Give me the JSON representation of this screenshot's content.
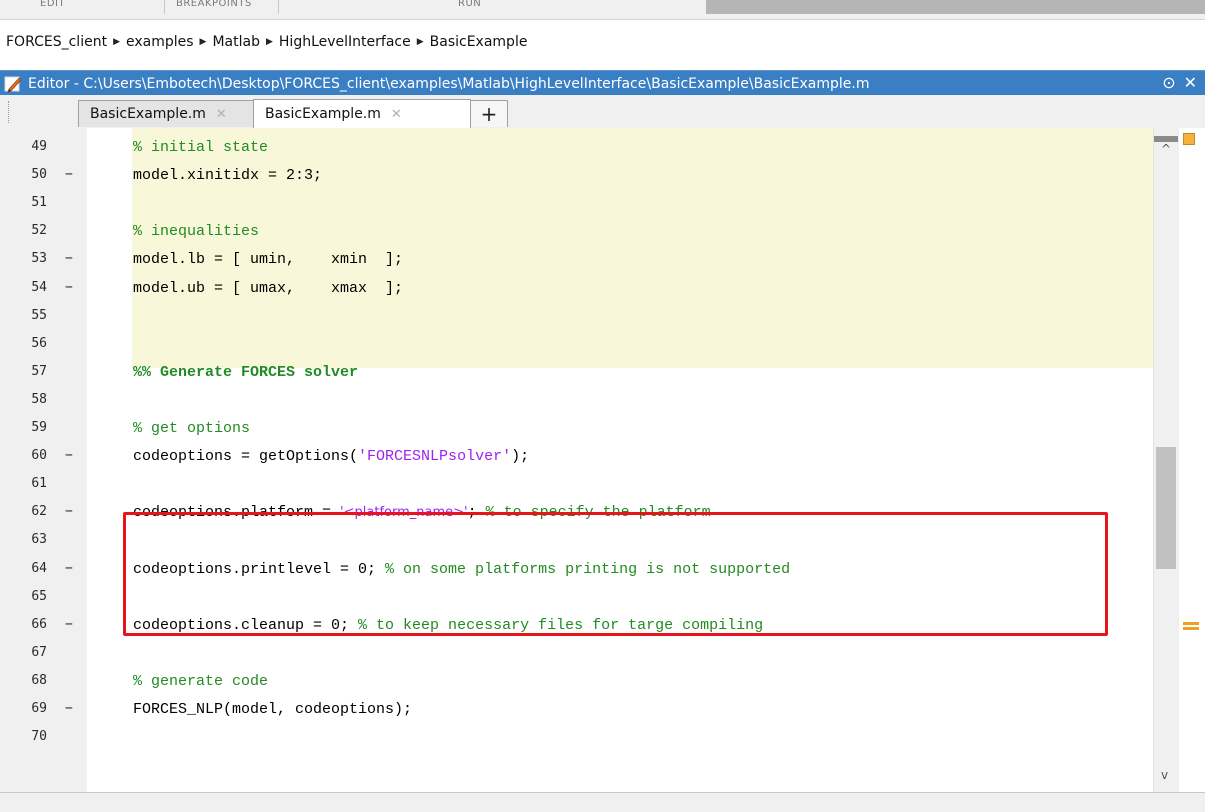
{
  "ribbon": {
    "sections": [
      "EDIT",
      "BREAKPOINTS",
      "RUN"
    ]
  },
  "breadcrumb": {
    "items": [
      "FORCES_client",
      "examples",
      "Matlab",
      "HighLevelInterface",
      "BasicExample"
    ],
    "separator": "▶"
  },
  "editor": {
    "title": "Editor - C:\\Users\\Embotech\\Desktop\\FORCES_client\\examples\\Matlab\\HighLevelInterface\\BasicExample\\BasicExample.m",
    "window_buttons": {
      "menu": "⊙",
      "close": "✕"
    },
    "tabs": [
      {
        "label": "BasicExample.m",
        "active": false
      },
      {
        "label": "BasicExample.m",
        "active": true
      }
    ],
    "tab_close_glyph": "✕",
    "new_tab_glyph": "+"
  },
  "code": {
    "lines": [
      {
        "n": "49",
        "exec": false
      },
      {
        "n": "50",
        "exec": true
      },
      {
        "n": "51",
        "exec": false
      },
      {
        "n": "52",
        "exec": false
      },
      {
        "n": "53",
        "exec": true
      },
      {
        "n": "54",
        "exec": true
      },
      {
        "n": "55",
        "exec": false
      },
      {
        "n": "56",
        "exec": false
      },
      {
        "n": "57",
        "exec": false
      },
      {
        "n": "58",
        "exec": false
      },
      {
        "n": "59",
        "exec": false
      },
      {
        "n": "60",
        "exec": true
      },
      {
        "n": "61",
        "exec": false
      },
      {
        "n": "62",
        "exec": true
      },
      {
        "n": "63",
        "exec": false
      },
      {
        "n": "64",
        "exec": true
      },
      {
        "n": "65",
        "exec": false
      },
      {
        "n": "66",
        "exec": true
      },
      {
        "n": "67",
        "exec": false
      },
      {
        "n": "68",
        "exec": false
      },
      {
        "n": "69",
        "exec": true
      },
      {
        "n": "70",
        "exec": false
      }
    ],
    "exec_marker": "−",
    "text": {
      "l49_comment": "% initial state",
      "l50": "model.xinitidx = 2:3;",
      "l52_comment": "% inequalities",
      "l53": "model.lb = [ umin,    xmin  ];",
      "l54": "model.ub = [ umax,    xmax  ];",
      "l57_cellhead": "%% Generate FORCES solver",
      "l59_comment": "% get options",
      "l60_a": "codeoptions = getOptions(",
      "l60_string": "'FORCESNLPsolver'",
      "l60_b": ");",
      "l62_a": "codeoptions.platform = ",
      "l62_string": "'<platform_name>'",
      "l62_b": "; ",
      "l62_comment": "% to specify the platform",
      "l64_a": "codeoptions.printlevel = 0; ",
      "l64_comment": "% on some platforms printing is not supported",
      "l66_a": "codeoptions.cleanup = 0; ",
      "l66_comment": "% to keep necessary files for targe compiling",
      "l68_comment": "% generate code",
      "l69": "FORCES_NLP(model, codeoptions);"
    }
  },
  "colors": {
    "title_bar": "#3a7fc4",
    "cell_highlight": "#f8f7d9",
    "comment": "#228b22",
    "string": "#a020f0",
    "callout_box": "#e8141b",
    "analyzer_status": "#f5b23b"
  },
  "icons": [
    "editor-pencil-icon",
    "window-menu-icon",
    "close-icon",
    "scroll-up-icon",
    "scroll-down-icon",
    "analyzer-status-icon",
    "warning-marker-icon"
  ]
}
